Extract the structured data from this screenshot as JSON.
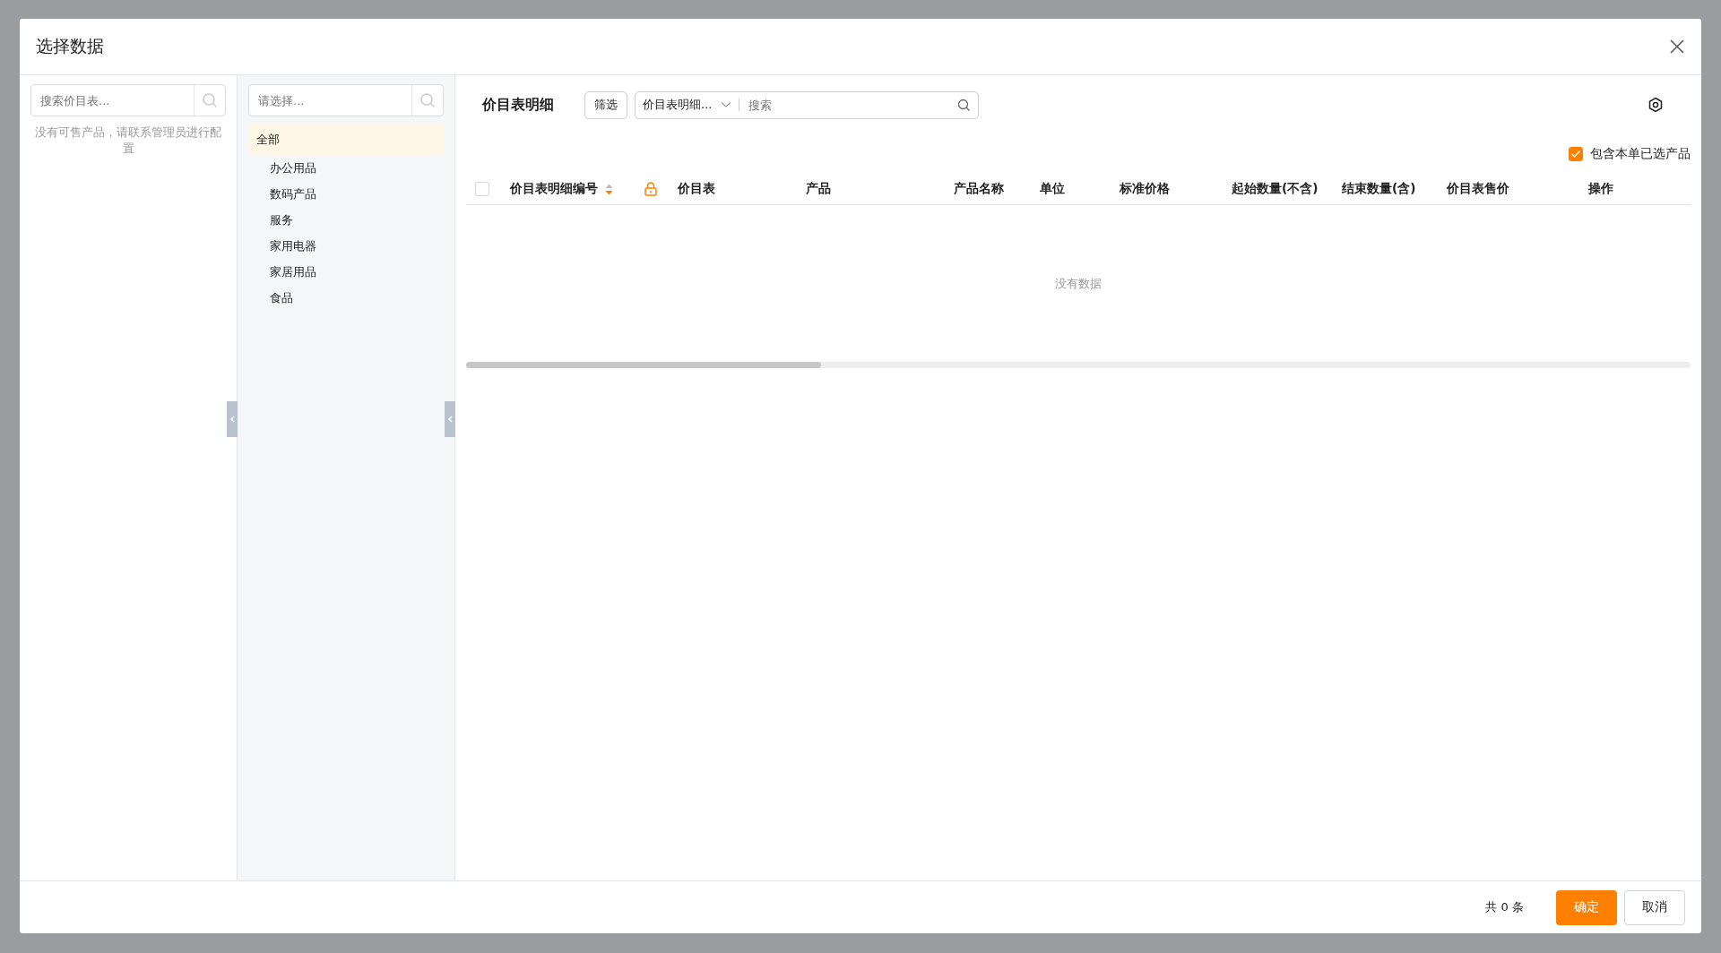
{
  "dialog": {
    "title": "选择数据"
  },
  "price_list_panel": {
    "search_placeholder": "搜索价目表...",
    "empty_message": "没有可售产品，请联系管理员进行配置"
  },
  "category_panel": {
    "search_placeholder": "请选择...",
    "categories": [
      {
        "label": "全部",
        "selected": true,
        "children": [
          {
            "label": "办公用品",
            "selected": false
          },
          {
            "label": "数码产品",
            "selected": false
          },
          {
            "label": "服务",
            "selected": false
          },
          {
            "label": "家用电器",
            "selected": false
          },
          {
            "label": "家居用品",
            "selected": false
          },
          {
            "label": "食品",
            "selected": false
          }
        ]
      }
    ]
  },
  "main": {
    "title": "价目表明细",
    "filter_button": "筛选",
    "search_scope": "价目表明细...",
    "search_placeholder": "搜索",
    "include_selected": {
      "label": "包含本单已选产品",
      "checked": true
    },
    "table": {
      "select_all_checked": false,
      "columns": [
        {
          "kind": "sortable",
          "label": "价目表明细编号"
        },
        {
          "kind": "lock"
        },
        {
          "kind": "text",
          "label": "价目表"
        },
        {
          "kind": "text",
          "label": "产品"
        },
        {
          "kind": "text",
          "label": "产品名称"
        },
        {
          "kind": "text",
          "label": "单位"
        },
        {
          "kind": "text",
          "label": "标准价格"
        },
        {
          "kind": "text",
          "label": "起始数量(不含)"
        },
        {
          "kind": "text",
          "label": "结束数量(含)"
        },
        {
          "kind": "text",
          "label": "价目表售价"
        },
        {
          "kind": "text",
          "label": "操作"
        }
      ],
      "empty_text": "没有数据"
    }
  },
  "footer": {
    "total": "共 0 条",
    "ok_button": "确定",
    "cancel_button": "取消"
  }
}
